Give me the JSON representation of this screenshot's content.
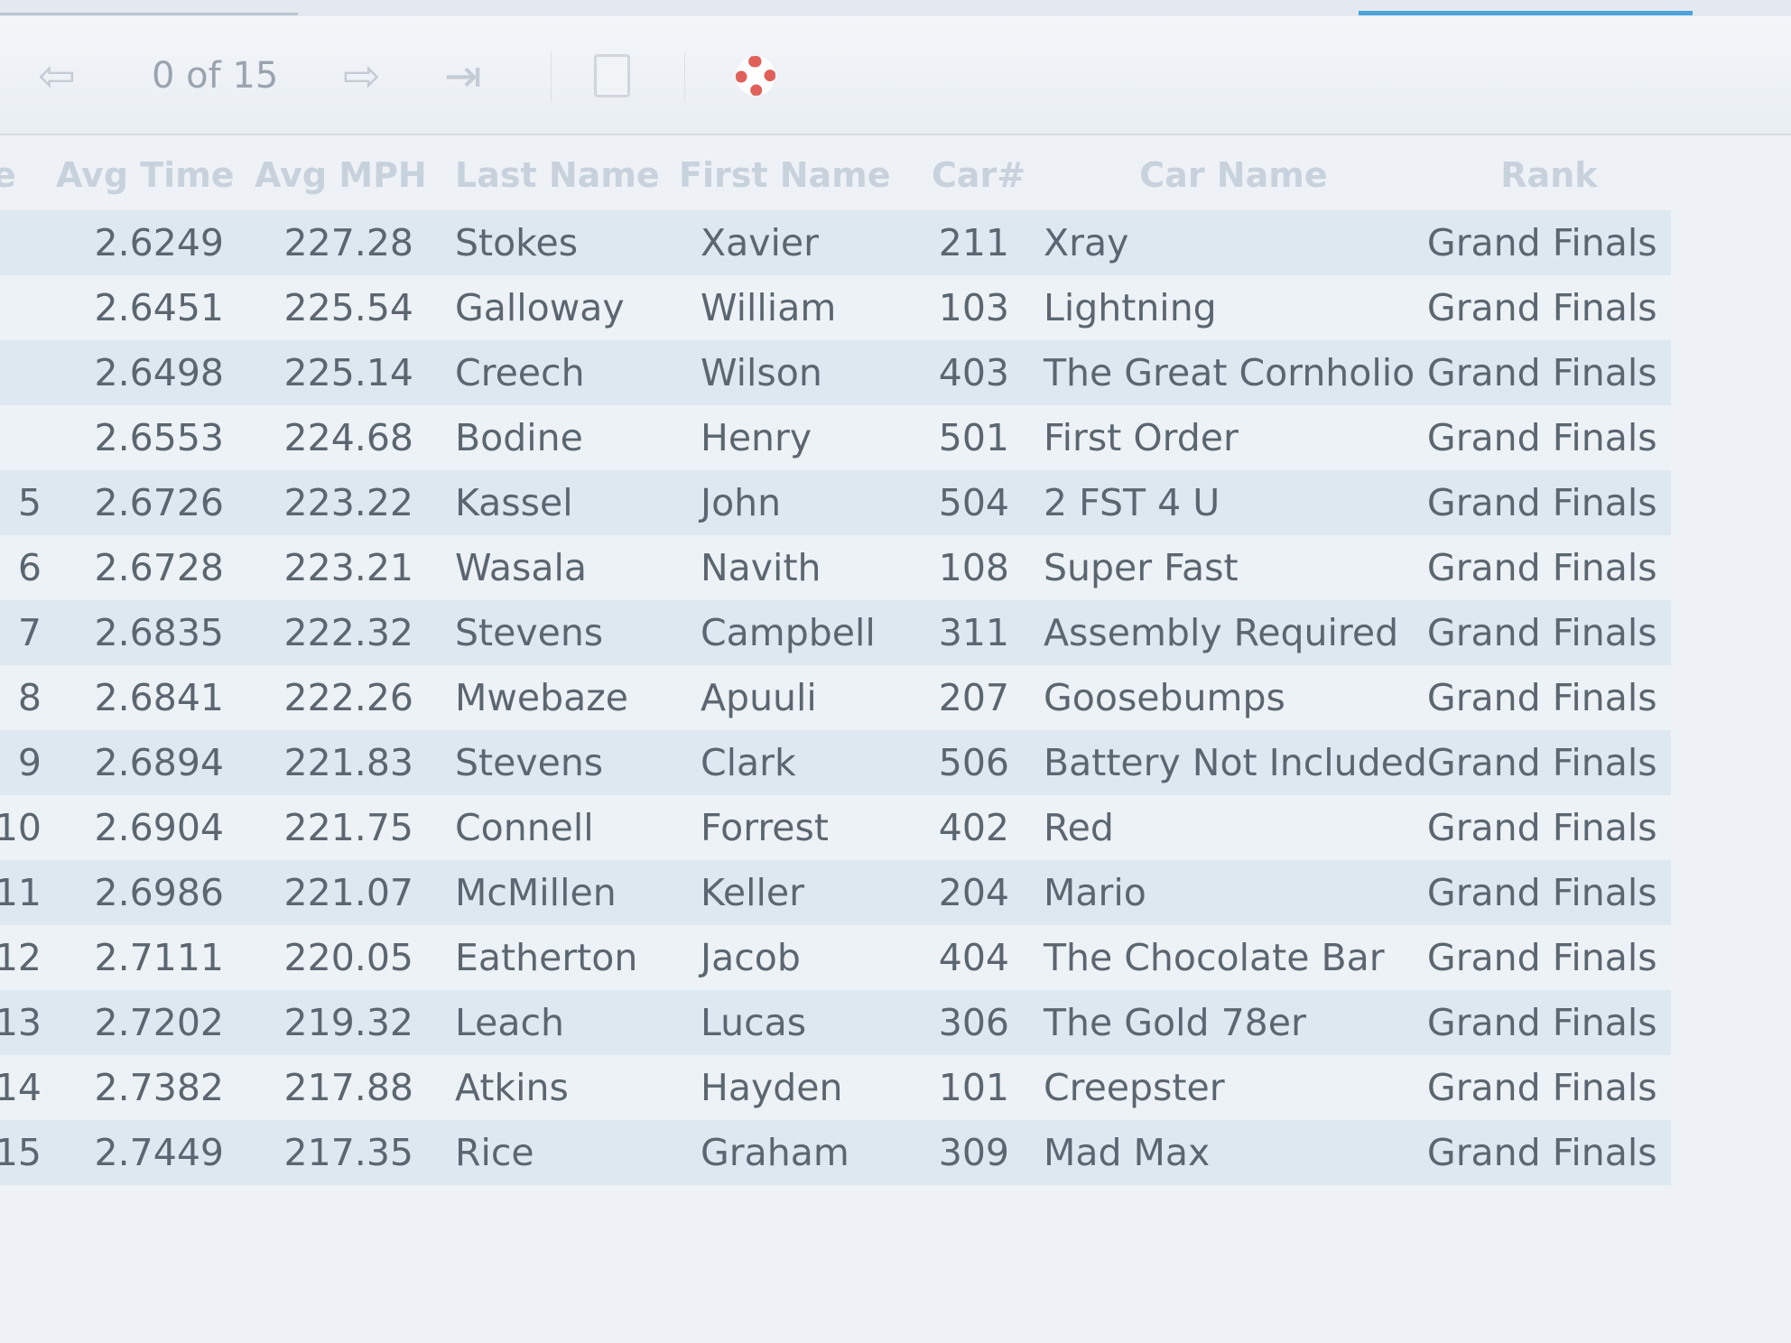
{
  "toolbar": {
    "counter": "0 of 15",
    "icons": [
      "back-arrow-icon",
      "forward-arrow-icon",
      "last-page-icon",
      "page-icon",
      "lifebuoy-icon"
    ]
  },
  "table": {
    "columns": [
      "e",
      "Avg Time",
      "Avg MPH",
      "Last Name",
      "First Name",
      "Car#",
      "Car Name",
      "Rank"
    ],
    "rows": [
      {
        "pos": "",
        "avg_time": "2.6249",
        "avg_mph": "227.28",
        "last": "Stokes",
        "first": "Xavier",
        "car": "211",
        "car_name": "Xray",
        "rank": "Grand Finals"
      },
      {
        "pos": "",
        "avg_time": "2.6451",
        "avg_mph": "225.54",
        "last": "Galloway",
        "first": "William",
        "car": "103",
        "car_name": "Lightning",
        "rank": "Grand Finals"
      },
      {
        "pos": "",
        "avg_time": "2.6498",
        "avg_mph": "225.14",
        "last": "Creech",
        "first": "Wilson",
        "car": "403",
        "car_name": "The Great Cornholio",
        "rank": "Grand Finals"
      },
      {
        "pos": "",
        "avg_time": "2.6553",
        "avg_mph": "224.68",
        "last": "Bodine",
        "first": "Henry",
        "car": "501",
        "car_name": "First Order",
        "rank": "Grand Finals"
      },
      {
        "pos": "5",
        "avg_time": "2.6726",
        "avg_mph": "223.22",
        "last": "Kassel",
        "first": "John",
        "car": "504",
        "car_name": "2 FST 4 U",
        "rank": "Grand Finals"
      },
      {
        "pos": "6",
        "avg_time": "2.6728",
        "avg_mph": "223.21",
        "last": "Wasala",
        "first": "Navith",
        "car": "108",
        "car_name": "Super Fast",
        "rank": "Grand Finals"
      },
      {
        "pos": "7",
        "avg_time": "2.6835",
        "avg_mph": "222.32",
        "last": "Stevens",
        "first": "Campbell",
        "car": "311",
        "car_name": "Assembly Required",
        "rank": "Grand Finals"
      },
      {
        "pos": "8",
        "avg_time": "2.6841",
        "avg_mph": "222.26",
        "last": "Mwebaze",
        "first": "Apuuli",
        "car": "207",
        "car_name": "Goosebumps",
        "rank": "Grand Finals"
      },
      {
        "pos": "9",
        "avg_time": "2.6894",
        "avg_mph": "221.83",
        "last": "Stevens",
        "first": "Clark",
        "car": "506",
        "car_name": "Battery Not Included",
        "rank": "Grand Finals"
      },
      {
        "pos": "10",
        "avg_time": "2.6904",
        "avg_mph": "221.75",
        "last": "Connell",
        "first": "Forrest",
        "car": "402",
        "car_name": "Red",
        "rank": "Grand Finals"
      },
      {
        "pos": "11",
        "avg_time": "2.6986",
        "avg_mph": "221.07",
        "last": "McMillen",
        "first": "Keller",
        "car": "204",
        "car_name": "Mario",
        "rank": "Grand Finals"
      },
      {
        "pos": "12",
        "avg_time": "2.7111",
        "avg_mph": "220.05",
        "last": "Eatherton",
        "first": "Jacob",
        "car": "404",
        "car_name": "The Chocolate Bar",
        "rank": "Grand Finals"
      },
      {
        "pos": "13",
        "avg_time": "2.7202",
        "avg_mph": "219.32",
        "last": "Leach",
        "first": "Lucas",
        "car": "306",
        "car_name": "The Gold 78er",
        "rank": "Grand Finals"
      },
      {
        "pos": "14",
        "avg_time": "2.7382",
        "avg_mph": "217.88",
        "last": "Atkins",
        "first": "Hayden",
        "car": "101",
        "car_name": "Creepster",
        "rank": "Grand Finals"
      },
      {
        "pos": "15",
        "avg_time": "2.7449",
        "avg_mph": "217.35",
        "last": "Rice",
        "first": "Graham",
        "car": "309",
        "car_name": "Mad Max",
        "rank": "Grand Finals"
      }
    ]
  }
}
